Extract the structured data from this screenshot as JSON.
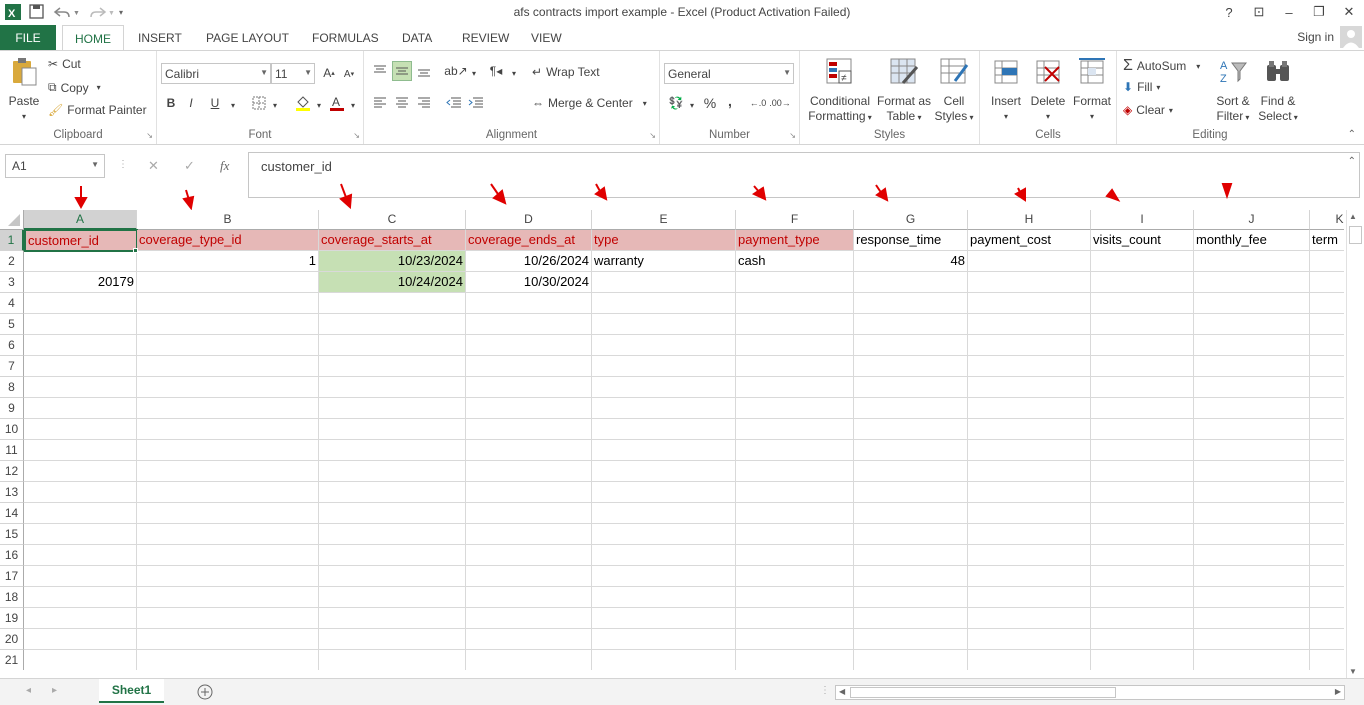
{
  "window": {
    "title": "afs contracts import example - Excel (Product Activation Failed)",
    "help": "?",
    "sign_in": "Sign in"
  },
  "tabs": [
    "FILE",
    "HOME",
    "INSERT",
    "PAGE LAYOUT",
    "FORMULAS",
    "DATA",
    "REVIEW",
    "VIEW"
  ],
  "ribbon": {
    "clipboard": {
      "paste": "Paste",
      "cut": "Cut",
      "copy": "Copy",
      "format_painter": "Format Painter",
      "label": "Clipboard"
    },
    "font": {
      "name": "Calibri",
      "size": "11",
      "bold": "B",
      "italic": "I",
      "underline": "U",
      "label": "Font"
    },
    "alignment": {
      "wrap_text": "Wrap Text",
      "merge_center": "Merge & Center",
      "label": "Alignment"
    },
    "number": {
      "format": "General",
      "percent": "%",
      "comma": ",",
      "label": "Number"
    },
    "styles": {
      "conditional": "Conditional",
      "formatting": "Formatting",
      "format_as": "Format as",
      "table": "Table",
      "cell": "Cell",
      "styles": "Styles",
      "label": "Styles"
    },
    "cells": {
      "insert": "Insert",
      "delete": "Delete",
      "format": "Format",
      "label": "Cells"
    },
    "editing": {
      "autosum": "AutoSum",
      "fill": "Fill",
      "clear": "Clear",
      "sort": "Sort &",
      "filter": "Filter",
      "find": "Find &",
      "select": "Select",
      "label": "Editing"
    }
  },
  "formula_bar": {
    "name_box": "A1",
    "fx": "fx",
    "content": "customer_id"
  },
  "columns": [
    "A",
    "B",
    "C",
    "D",
    "E",
    "F",
    "G",
    "H",
    "I",
    "J",
    "K"
  ],
  "rows": [
    "1",
    "2",
    "3",
    "4",
    "5",
    "6",
    "7",
    "8",
    "9",
    "10",
    "11",
    "12",
    "13",
    "14",
    "15",
    "16",
    "17",
    "18",
    "19",
    "20",
    "21"
  ],
  "cells": {
    "header": [
      "customer_id",
      "coverage_type_id",
      "coverage_starts_at",
      "coverage_ends_at",
      "type",
      "payment_type",
      "response_time",
      "payment_cost",
      "visits_count",
      "monthly_fee",
      "term"
    ],
    "row2": {
      "b": "1",
      "c": "10/23/2024",
      "d": "10/26/2024",
      "e": "warranty",
      "f": "cash",
      "g": "48"
    },
    "row3": {
      "a": "20179",
      "c": "10/24/2024",
      "d": "10/30/2024"
    }
  },
  "sheet": {
    "tab": "Sheet1"
  },
  "colors": {
    "accent": "#217346",
    "highlight_fill": "#e6b8b7",
    "highlight_text": "#c00000",
    "green_fill": "#c6e0b4",
    "arrow": "#e00000"
  }
}
